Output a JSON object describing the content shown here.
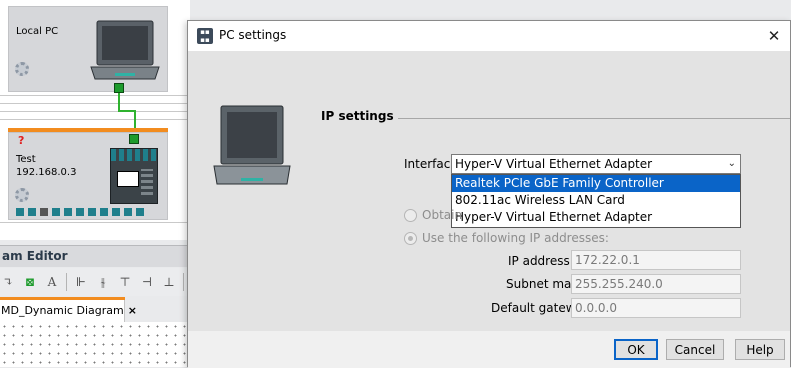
{
  "background": {
    "devices": [
      {
        "name": "Local PC"
      },
      {
        "name": "Test",
        "ip": "192.168.0.3"
      }
    ],
    "status_mark": "?",
    "editor_title": "am Editor",
    "toolbar_text_icon": "A",
    "diagram_tab": {
      "label": "MD_Dynamic Diagram",
      "close": "×"
    }
  },
  "dialog": {
    "title": "PC settings",
    "close_glyph": "✕",
    "section_title": "IP settings",
    "interface_label": "Interface:",
    "interface_selected": "Hyper-V Virtual Ethernet Adapter",
    "interface_options": [
      "Realtek PCIe GbE Family Controller",
      "802.11ac Wireless LAN Card",
      "Hyper-V Virtual Ethernet Adapter"
    ],
    "highlighted_option_index": 0,
    "radio_obtain_label": "Obtain",
    "radio_use_label": "Use the following IP addresses:",
    "ip_label": "IP address:",
    "ip_value": "172.22.0.1",
    "subnet_label": "Subnet mask:",
    "subnet_value": "255.255.240.0",
    "gateway_label": "Default gateway:",
    "gateway_value": "0.0.0.0",
    "buttons": {
      "ok": "OK",
      "cancel": "Cancel",
      "help": "Help"
    }
  },
  "colors": {
    "accent": "#0a64c8",
    "orange": "#f28c1f",
    "link_green": "#2fb22f"
  }
}
